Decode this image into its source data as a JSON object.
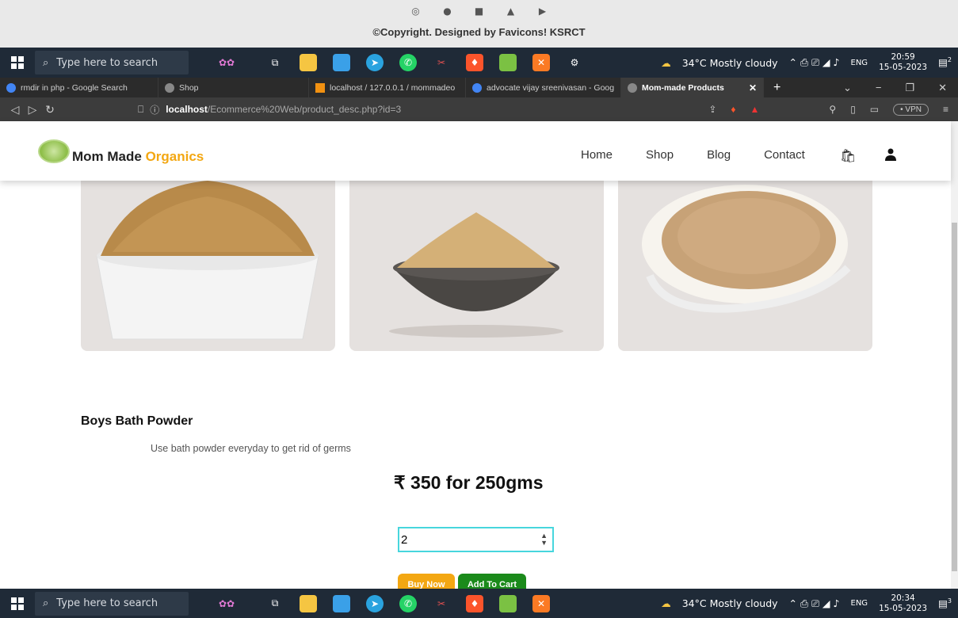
{
  "footer": {
    "icons": [
      "instagram-icon",
      "facebook-icon",
      "linkedin-icon",
      "twitter-icon",
      "youtube-icon"
    ],
    "copyright": "©Copyright. Designed by Favicons! KSRCT"
  },
  "taskbar_top": {
    "search_placeholder": "Type here to search",
    "weather": "34°C  Mostly cloudy",
    "lang": "ENG",
    "time": "20:59",
    "date": "15-05-2023",
    "notif": "2"
  },
  "taskbar_bottom": {
    "search_placeholder": "Type here to search",
    "weather": "34°C  Mostly cloudy",
    "lang": "ENG",
    "time": "20:34",
    "date": "15-05-2023",
    "notif": "3"
  },
  "browser": {
    "tabs": [
      {
        "label": "rmdir in php - Google Search",
        "color": "#4285f4"
      },
      {
        "label": "Shop",
        "color": "#888888"
      },
      {
        "label": "localhost / 127.0.0.1 / mommadeo",
        "color": "#f29111"
      },
      {
        "label": "advocate vijay sreenivasan - Goog",
        "color": "#4285f4"
      },
      {
        "label": "Mom-made Products",
        "color": "#888888"
      }
    ],
    "url_host": "localhost",
    "url_path": "/Ecommerce%20Web/product_desc.php?id=3",
    "vpn": "• VPN"
  },
  "site": {
    "brand_main": "Mom Made ",
    "brand_accent": "Organics",
    "nav": [
      "Home",
      "Shop",
      "Blog",
      "Contact"
    ]
  },
  "product": {
    "title": "Boys Bath Powder",
    "description": "Use bath powder everyday to get rid of germs",
    "price": "₹ 350 for 250gms",
    "quantity": "2",
    "buy_label": "Buy Now",
    "cart_label": "Add To Cart"
  },
  "colors": {
    "accent": "#f3a712",
    "cart_green": "#1b8a1b",
    "focus_cyan": "#47d6dd"
  }
}
